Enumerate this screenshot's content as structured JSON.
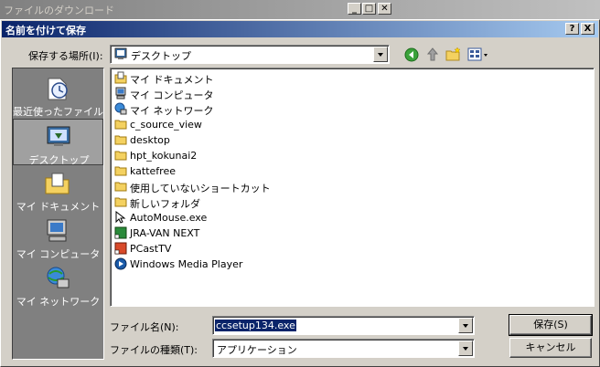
{
  "background_window": {
    "title": "ファイルのダウンロード"
  },
  "dialog": {
    "title": "名前を付けて保存",
    "help_button": "?",
    "close_button": "X"
  },
  "location": {
    "label": "保存する場所(I):",
    "value": "デスクトップ"
  },
  "places": [
    {
      "label": "最近使ったファイル",
      "icon": "recent-icon"
    },
    {
      "label": "デスクトップ",
      "icon": "desktop-icon",
      "active": true
    },
    {
      "label": "マイ ドキュメント",
      "icon": "my-documents-icon"
    },
    {
      "label": "マイ コンピュータ",
      "icon": "my-computer-icon"
    },
    {
      "label": "マイ ネットワーク",
      "icon": "my-network-icon"
    }
  ],
  "files": [
    {
      "name": "マイ ドキュメント",
      "icon": "my-documents-icon"
    },
    {
      "name": "マイ コンピュータ",
      "icon": "my-computer-icon"
    },
    {
      "name": "マイ ネットワーク",
      "icon": "my-network-icon"
    },
    {
      "name": "c_source_view",
      "icon": "folder-icon"
    },
    {
      "name": "desktop",
      "icon": "folder-icon"
    },
    {
      "name": "hpt_kokunai2",
      "icon": "folder-icon"
    },
    {
      "name": "kattefree",
      "icon": "folder-icon"
    },
    {
      "name": "使用していないショートカット",
      "icon": "folder-icon"
    },
    {
      "name": "新しいフォルダ",
      "icon": "folder-icon"
    },
    {
      "name": "AutoMouse.exe",
      "icon": "cursor-shortcut-icon"
    },
    {
      "name": "JRA-VAN NEXT",
      "icon": "app-shortcut-icon"
    },
    {
      "name": "PCastTV",
      "icon": "app-shortcut-icon"
    },
    {
      "name": "Windows Media Player",
      "icon": "media-player-icon"
    }
  ],
  "filename": {
    "label": "ファイル名(N):",
    "value": "ccsetup134.exe"
  },
  "filetype": {
    "label": "ファイルの種類(T):",
    "value": "アプリケーション"
  },
  "buttons": {
    "save": "保存(S)",
    "cancel": "キャンセル"
  }
}
